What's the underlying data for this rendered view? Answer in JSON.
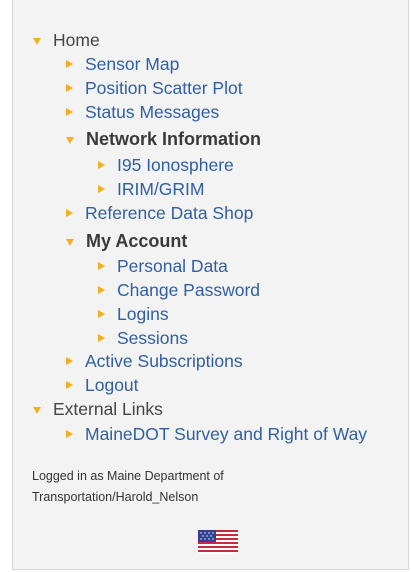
{
  "menu": {
    "home": "Home",
    "sensor_map": "Sensor Map",
    "position_scatter_plot": "Position Scatter Plot",
    "status_messages": "Status Messages",
    "network_information": "Network Information",
    "i95_ionosphere": "I95 Ionosphere",
    "irim_grim": "IRIM/GRIM",
    "reference_data_shop": "Reference Data Shop",
    "my_account": "My Account",
    "personal_data": "Personal Data",
    "change_password": "Change Password",
    "logins": "Logins",
    "sessions": "Sessions",
    "active_subscriptions": "Active Subscriptions",
    "logout": "Logout",
    "external_links": "External Links",
    "mainedot_survey": "MaineDOT Survey and Right of Way"
  },
  "status": {
    "logged_in_line1": "Logged in as Maine Department of",
    "logged_in_line2": "Transportation/Harold_Nelson"
  },
  "icons": {
    "expanded": "triangle-down-icon",
    "collapsed": "triangle-right-icon",
    "flag": "us-flag-icon"
  },
  "colors": {
    "link": "#2f5fa3",
    "arrow": "#f2b01e",
    "heading": "#3a3a3a",
    "panel_bg": "#f3f3f3"
  }
}
